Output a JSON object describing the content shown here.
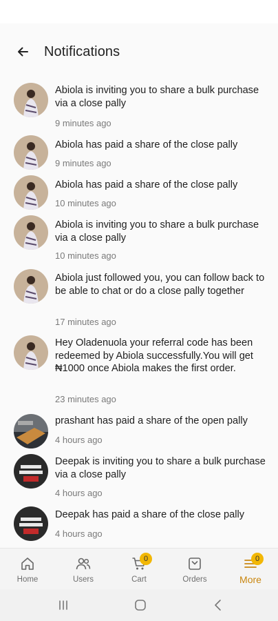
{
  "header": {
    "title": "Notifications",
    "back_icon": "back-arrow-icon"
  },
  "notifications": [
    {
      "text": "Abiola is inviting you to share a bulk purchase via a close pally",
      "time": "9 minutes ago",
      "avatar": "abiola"
    },
    {
      "text": "Abiola has paid a share of the close pally",
      "time": "9 minutes ago",
      "avatar": "abiola"
    },
    {
      "text": "Abiola has paid a share of the close pally",
      "time": "10 minutes ago",
      "avatar": "abiola"
    },
    {
      "text": "Abiola is inviting you to share a bulk purchase via a close pally",
      "time": "10 minutes ago",
      "avatar": "abiola"
    },
    {
      "text": "Abiola just followed you, you can follow back to be able to chat or do a close pally together",
      "time": "17 minutes ago",
      "avatar": "abiola"
    },
    {
      "text": "Hey Oladenuola your referral code has been redeemed by Abiola successfully.You will get ₦1000 once Abiola makes the first order.",
      "time": "23 minutes ago",
      "avatar": "abiola"
    },
    {
      "text": "prashant has paid a share of the open pally",
      "time": "4 hours ago",
      "avatar": "prashant"
    },
    {
      "text": "Deepak is inviting you to share a bulk purchase via a close pally",
      "time": "4 hours ago",
      "avatar": "deepak"
    },
    {
      "text": "Deepak has paid a share of the close pally",
      "time": "4 hours ago",
      "avatar": "deepak"
    }
  ],
  "bottom_nav": {
    "items": [
      {
        "label": "Home",
        "icon": "home-icon"
      },
      {
        "label": "Users",
        "icon": "users-icon"
      },
      {
        "label": "Cart",
        "icon": "cart-icon",
        "badge": "0"
      },
      {
        "label": "Orders",
        "icon": "orders-icon"
      },
      {
        "label": "More",
        "icon": "menu-icon",
        "badge": "0",
        "active": true
      }
    ]
  },
  "colors": {
    "accent": "#c9860f",
    "badge": "#f2b705",
    "background": "#fafafa"
  }
}
